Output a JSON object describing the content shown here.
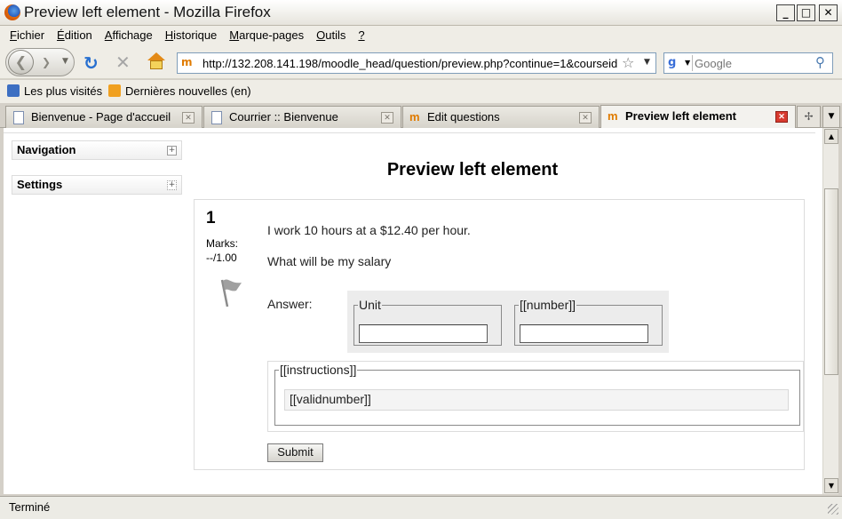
{
  "window": {
    "title": "Preview left element - Mozilla Firefox",
    "controls": {
      "minimize": "_",
      "maximize": "□",
      "close": "✕"
    }
  },
  "menubar": {
    "items": [
      {
        "u": "F",
        "rest": "ichier"
      },
      {
        "u": "É",
        "rest": "dition"
      },
      {
        "u": "A",
        "rest": "ffichage"
      },
      {
        "u": "H",
        "rest": "istorique"
      },
      {
        "u": "M",
        "rest": "arque-pages"
      },
      {
        "u": "O",
        "rest": "utils"
      },
      {
        "u": "?",
        "rest": ""
      }
    ]
  },
  "navbar": {
    "url": "http://132.208.141.198/moodle_head/question/preview.php?continue=1&courseid",
    "search_placeholder": "Google",
    "site_icon_text": "m",
    "search_engine_icon_text": "g"
  },
  "bookmarks": {
    "items": [
      {
        "label": "Les plus visités",
        "icon": "blue"
      },
      {
        "label": "Dernières nouvelles (en)",
        "icon": "rss"
      }
    ]
  },
  "tabs": [
    {
      "label": "Bienvenue - Page d'accueil",
      "icon": "page",
      "active": false
    },
    {
      "label": "Courrier :: Bienvenue",
      "icon": "page",
      "active": false
    },
    {
      "label": "Edit questions",
      "icon": "moodle",
      "active": false
    },
    {
      "label": "Preview left element",
      "icon": "moodle",
      "active": true
    }
  ],
  "sidebar": {
    "blocks": [
      {
        "title": "Navigation",
        "icon": "+"
      },
      {
        "title": "Settings",
        "icon": "+"
      }
    ]
  },
  "page": {
    "title": "Preview left element"
  },
  "question": {
    "number": "1",
    "marks_label": "Marks:",
    "marks_value": "--/1.00",
    "text_lines": [
      "I work 10 hours at a $12.40 per hour.",
      "What will be my salary"
    ],
    "answer_label": "Answer:",
    "unit_legend": "Unit",
    "number_legend": "[[number]]",
    "unit_value": "",
    "number_value": "",
    "instructions_legend": "[[instructions]]",
    "validnumber_text": "[[validnumber]]",
    "submit_label": "Submit"
  },
  "statusbar": {
    "text": "Terminé"
  },
  "colors": {
    "active_tab_close": "#d83a2e",
    "moodle_orange": "#e07b00",
    "link_blue": "#2870d0"
  }
}
